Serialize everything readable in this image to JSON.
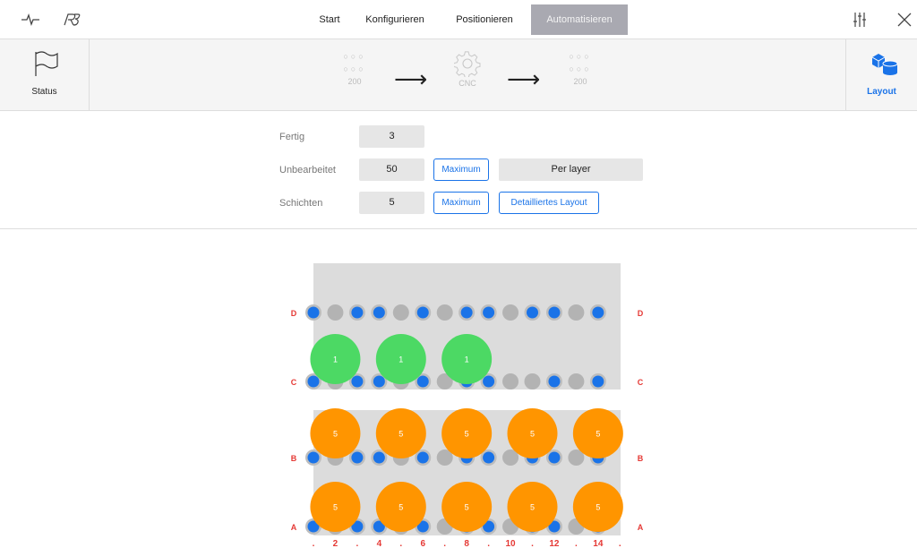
{
  "topbar": {
    "left_icons": [
      "pulse-icon",
      "robot-logo-icon"
    ],
    "tabs": [
      {
        "label": "Start",
        "active": false
      },
      {
        "label": "Konfigurieren",
        "active": false
      },
      {
        "label": "Positionieren",
        "active": false
      },
      {
        "label": "Automatisieren",
        "active": true
      }
    ],
    "right_icons": [
      "sliders-icon",
      "close-icon"
    ]
  },
  "flow": {
    "status_label": "Status",
    "input_count": "200",
    "machine_label": "CNC",
    "output_count": "200",
    "layout_label": "Layout"
  },
  "form": {
    "fertig_label": "Fertig",
    "fertig_value": "3",
    "unbearbeitet_label": "Unbearbeitet",
    "unbearbeitet_value": "50",
    "maximum_label": "Maximum",
    "per_layer_label": "Per layer",
    "schichten_label": "Schichten",
    "schichten_value": "5",
    "maximum2_label": "Maximum",
    "detailliertes_layout_label": "Detailliertes Layout"
  },
  "layout_grid": {
    "row_labels": [
      "D",
      "C",
      "B",
      "A"
    ],
    "column_labels": [
      ".",
      "2",
      ".",
      "4",
      ".",
      "6",
      ".",
      "8",
      ".",
      "10",
      ".",
      "12",
      ".",
      "14",
      "."
    ],
    "pin_rows": {
      "D": [
        "b",
        "g",
        "b",
        "b",
        "g",
        "b",
        "g",
        "b",
        "b",
        "g",
        "b",
        "b",
        "g",
        "b"
      ],
      "C": [
        "b",
        "g",
        "b",
        "b",
        "g",
        "b",
        "g",
        "b",
        "b",
        "g",
        "g",
        "b",
        "g",
        "b"
      ],
      "B": [
        "b",
        "g",
        "b",
        "b",
        "g",
        "b",
        "g",
        "b",
        "b",
        "g",
        "b",
        "b",
        "g",
        "b"
      ],
      "A": [
        "b",
        "g",
        "b",
        "b",
        "g",
        "b",
        "g",
        "b",
        "b",
        "g",
        "b",
        "b",
        "g",
        "b"
      ]
    },
    "finished_parts": [
      {
        "row": "C",
        "column": 2,
        "label": "1"
      },
      {
        "row": "C",
        "column": 5,
        "label": "1"
      },
      {
        "row": "C",
        "column": 8,
        "label": "1"
      }
    ],
    "raw_parts_upper": [
      {
        "row": "B",
        "column": 2,
        "label": "5"
      },
      {
        "row": "B",
        "column": 5,
        "label": "5"
      },
      {
        "row": "B",
        "column": 8,
        "label": "5"
      },
      {
        "row": "B",
        "column": 11,
        "label": "5"
      },
      {
        "row": "B",
        "column": 14,
        "label": "5"
      }
    ],
    "raw_parts_lower": [
      {
        "row": "A",
        "column": 2,
        "label": "5"
      },
      {
        "row": "A",
        "column": 5,
        "label": "5"
      },
      {
        "row": "A",
        "column": 8,
        "label": "5"
      },
      {
        "row": "A",
        "column": 11,
        "label": "5"
      },
      {
        "row": "A",
        "column": 14,
        "label": "5"
      }
    ]
  },
  "colors": {
    "accent": "#1a73e8",
    "pin_blue": "#1a73e8",
    "pin_grey": "#b3b3b3",
    "finished": "#4cd964",
    "raw": "#ff9500",
    "label_red": "#e53935"
  }
}
